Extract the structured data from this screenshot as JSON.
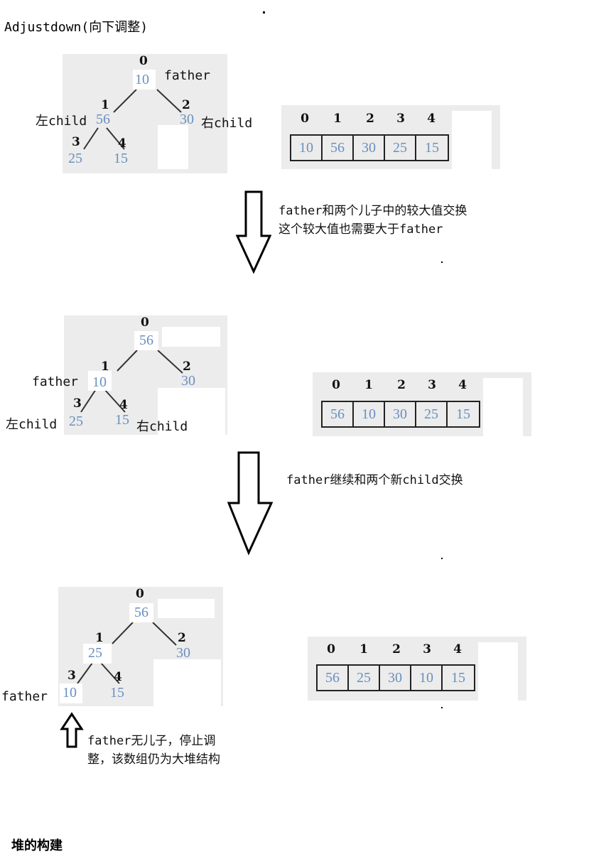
{
  "title": "Adjustdown(向下调整)",
  "footer_heading": "堆的构建",
  "stages": [
    {
      "tree": {
        "indices": [
          "0",
          "1",
          "2",
          "3",
          "4"
        ],
        "values": [
          "10",
          "56",
          "30",
          "25",
          "15"
        ],
        "labels": {
          "father": "father",
          "left_child": "左child",
          "right_child": "右child"
        }
      },
      "array": {
        "indices": [
          "0",
          "1",
          "2",
          "3",
          "4"
        ],
        "values": [
          "10",
          "56",
          "30",
          "25",
          "15"
        ]
      }
    },
    {
      "tree": {
        "indices": [
          "0",
          "1",
          "2",
          "3",
          "4"
        ],
        "values": [
          "56",
          "10",
          "30",
          "25",
          "15"
        ],
        "labels": {
          "father": "father",
          "left_child": "左child",
          "right_child": "右child"
        }
      },
      "array": {
        "indices": [
          "0",
          "1",
          "2",
          "3",
          "4"
        ],
        "values": [
          "56",
          "10",
          "30",
          "25",
          "15"
        ]
      }
    },
    {
      "tree": {
        "indices": [
          "0",
          "1",
          "2",
          "3",
          "4"
        ],
        "values": [
          "56",
          "25",
          "30",
          "10",
          "15"
        ],
        "labels": {
          "father": "father"
        }
      },
      "array": {
        "indices": [
          "0",
          "1",
          "2",
          "3",
          "4"
        ],
        "values": [
          "56",
          "25",
          "30",
          "10",
          "15"
        ]
      }
    }
  ],
  "captions": {
    "step1_line1": "father和两个儿子中的较大值交换",
    "step1_line2": "这个较大值也需要大于father",
    "step2": "father继续和两个新child交换",
    "step3_line1": "father无儿子，停止调",
    "step3_line2": "整，该数组仍为大堆结构"
  },
  "icons": {
    "down_arrow": "down-arrow-icon",
    "up_arrow": "up-arrow-icon"
  }
}
